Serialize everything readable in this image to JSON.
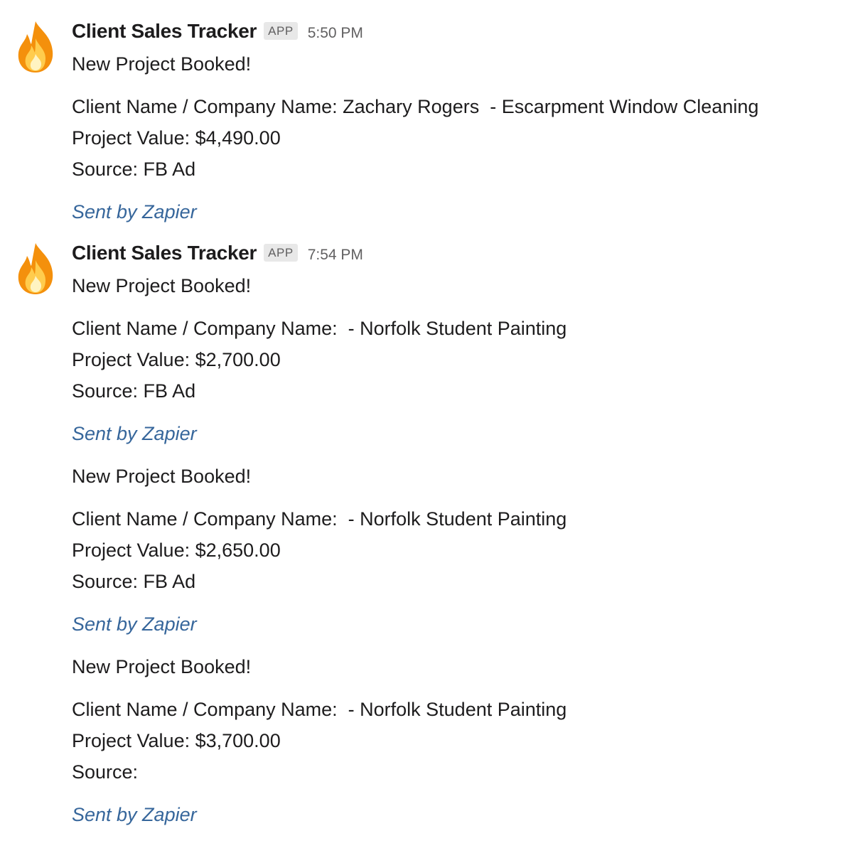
{
  "messages": [
    {
      "sender": "Client Sales Tracker",
      "badge": "APP",
      "time": "5:50 PM",
      "heading": "New Project Booked!",
      "client": "Client Name / Company Name: Zachary Rogers  - Escarpment Window Cleaning",
      "value": "Project Value: $4,490.00",
      "source": "Source: FB Ad",
      "footer": "Sent by Zapier"
    },
    {
      "sender": "Client Sales Tracker",
      "badge": "APP",
      "time": "7:54 PM",
      "heading": "New Project Booked!",
      "client": "Client Name / Company Name:  - Norfolk Student Painting",
      "value": "Project Value: $2,700.00",
      "source": "Source: FB Ad",
      "footer": "Sent by Zapier"
    },
    {
      "heading": "New Project Booked!",
      "client": "Client Name / Company Name:  - Norfolk Student Painting",
      "value": "Project Value: $2,650.00",
      "source": "Source: FB Ad",
      "footer": "Sent by Zapier"
    },
    {
      "heading": "New Project Booked!",
      "client": "Client Name / Company Name:  - Norfolk Student Painting",
      "value": "Project Value: $3,700.00",
      "source": "Source:",
      "footer": "Sent by Zapier"
    }
  ],
  "avatar_icon": "fire-icon"
}
